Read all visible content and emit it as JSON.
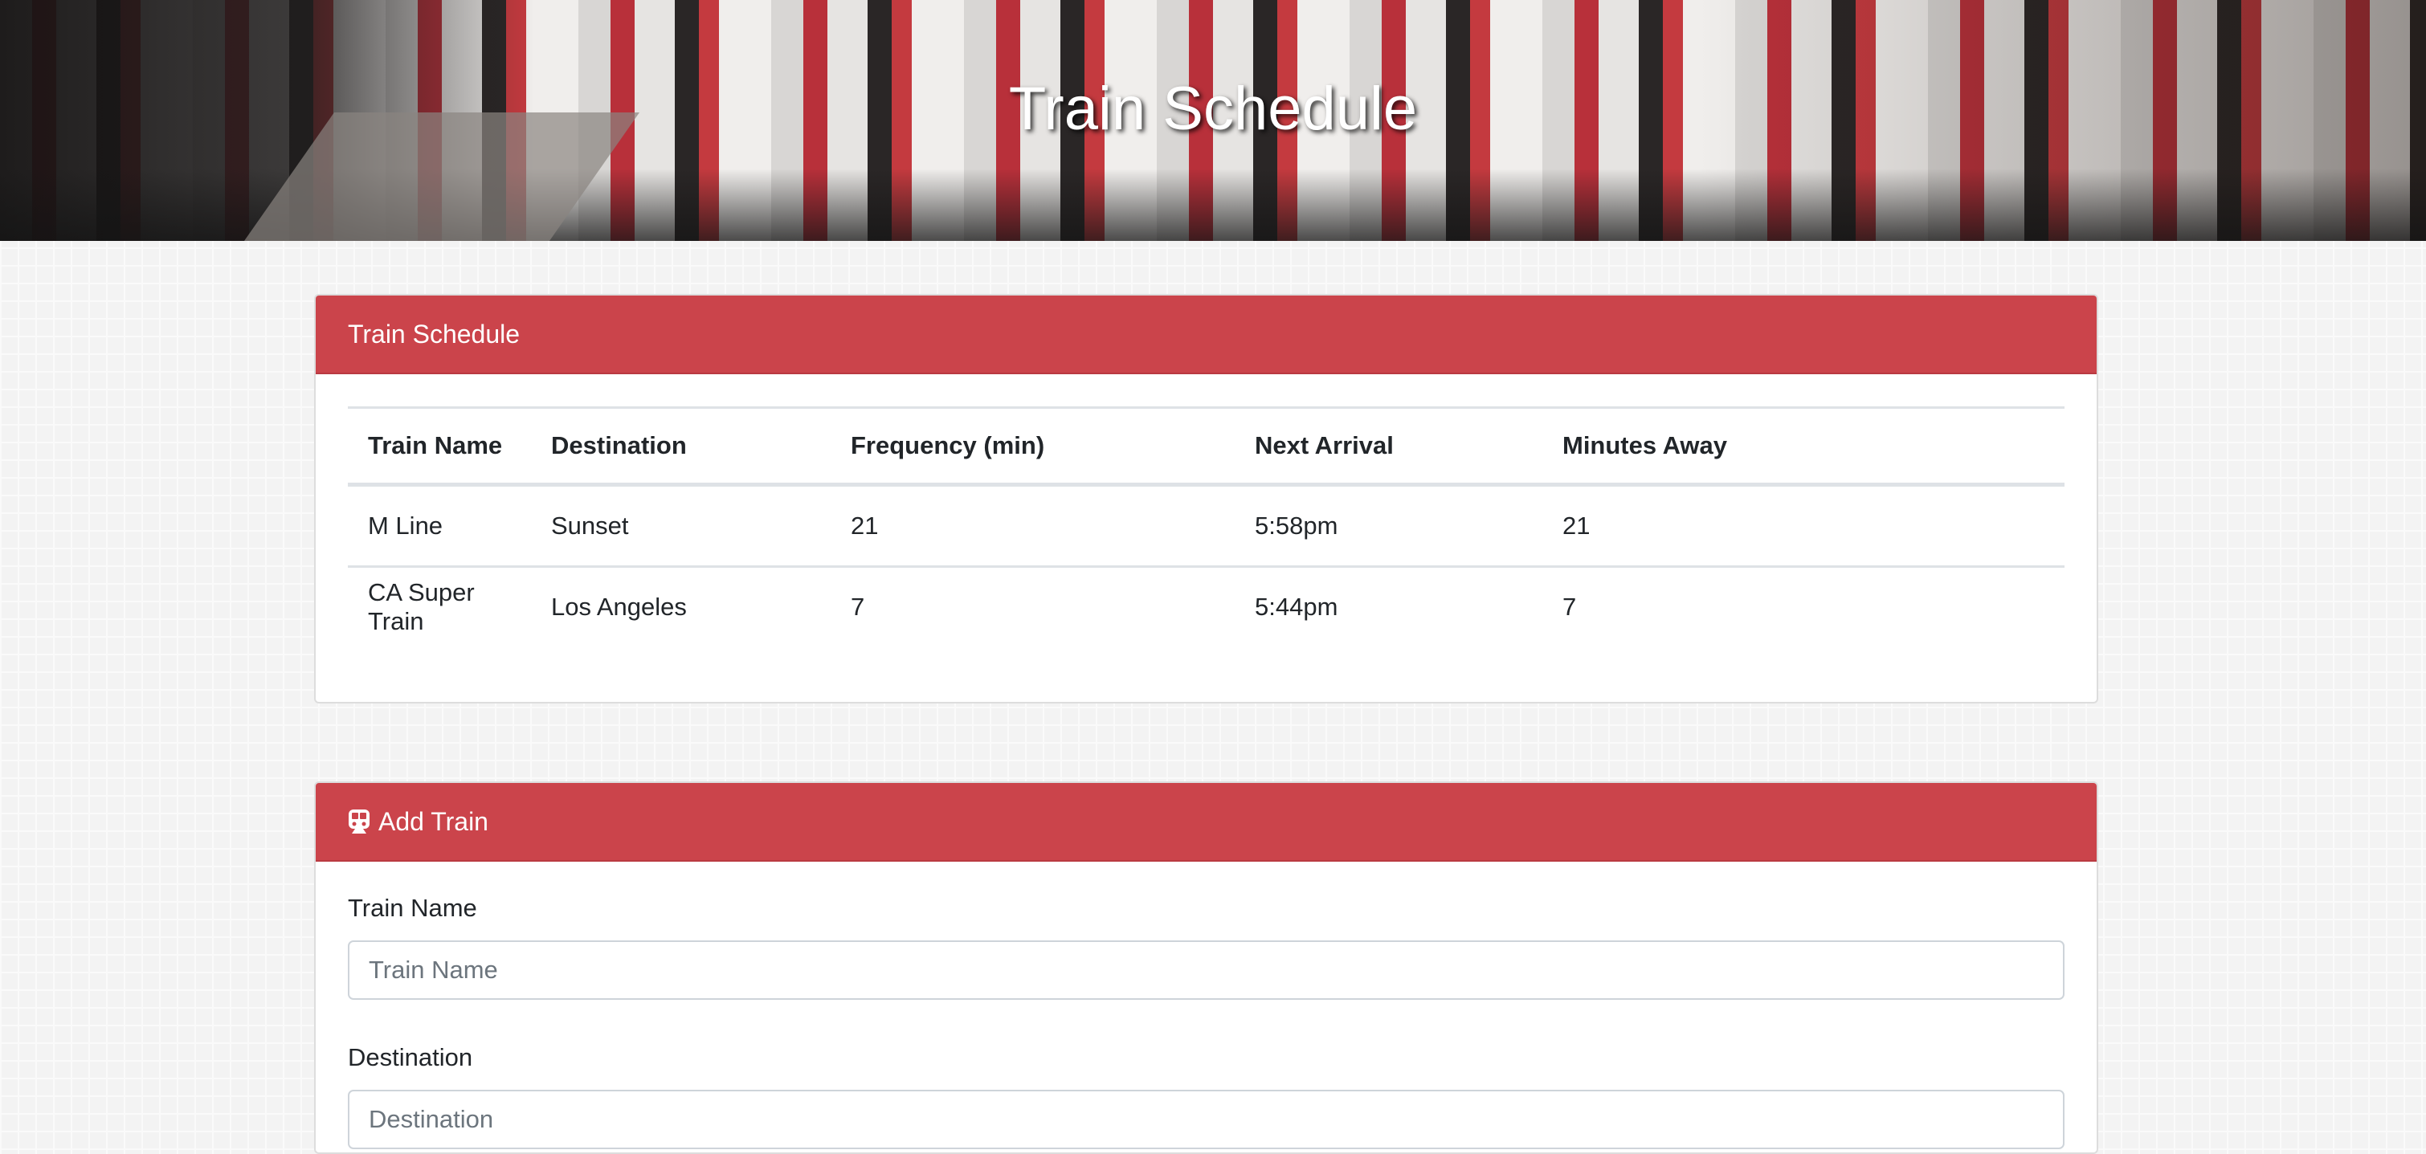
{
  "hero": {
    "title": "Train Schedule"
  },
  "schedule": {
    "title": "Train Schedule",
    "columns": [
      "Train Name",
      "Destination",
      "Frequency (min)",
      "Next Arrival",
      "Minutes Away"
    ],
    "rows": [
      [
        "M Line",
        "Sunset",
        "21",
        "5:58pm",
        "21"
      ],
      [
        "CA Super Train",
        "Los Angeles",
        "7",
        "5:44pm",
        "7"
      ]
    ]
  },
  "add_train": {
    "title": "Add Train",
    "icon": "train-icon",
    "fields": [
      {
        "label": "Train Name",
        "placeholder": "Train Name",
        "value": ""
      },
      {
        "label": "Destination",
        "placeholder": "Destination",
        "value": ""
      }
    ]
  },
  "colors": {
    "accent": "#cb444b"
  }
}
